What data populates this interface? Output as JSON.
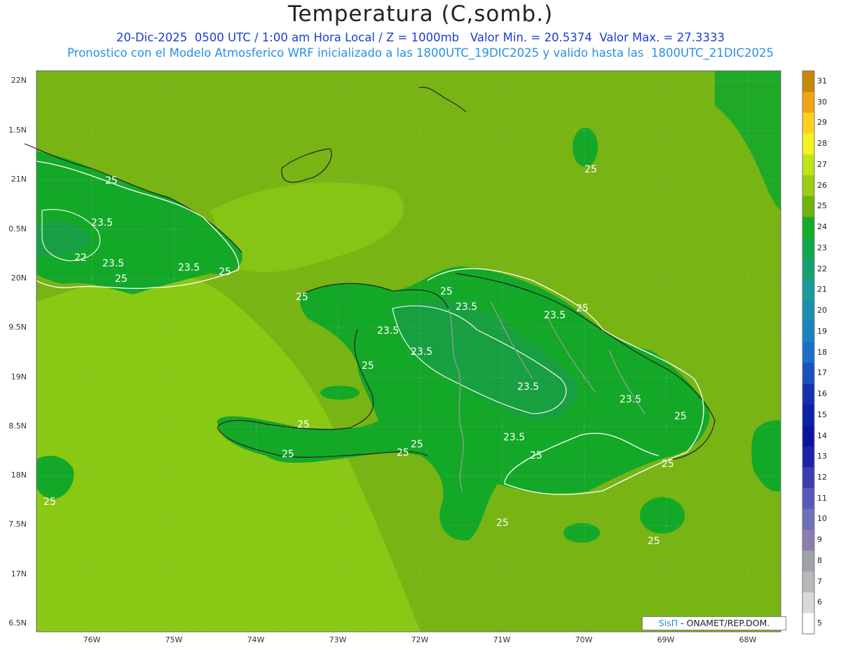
{
  "title": "Temperatura (C,somb.)",
  "subtitle1": "20-Dic-2025  0500 UTC / 1:00 am Hora Local / Z = 1000mb   Valor Min. = 20.5374  Valor Max. = 27.3333",
  "subtitle2": "Pronostico con el Modelo Atmosferico WRF inicializado a las 1800UTC_19DIC2025 y valido hasta las  1800UTC_21DIC2025",
  "lat_labels": [
    "22N",
    "1.5N",
    "21N",
    "0.5N",
    "20N",
    "9.5N",
    "19N",
    "8.5N",
    "18N",
    "7.5N",
    "17N",
    "6.5N"
  ],
  "lon_labels": [
    "76W",
    "75W",
    "74W",
    "73W",
    "72W",
    "71W",
    "70W",
    "69W",
    "68W"
  ],
  "colorbar": {
    "levels": [
      "5",
      "6",
      "7",
      "8",
      "9",
      "10",
      "11",
      "12",
      "13",
      "14",
      "15",
      "16",
      "17",
      "18",
      "19",
      "20",
      "21",
      "22",
      "23",
      "24",
      "25",
      "26",
      "27",
      "28",
      "29",
      "30",
      "31"
    ],
    "colors": [
      "#ffffff",
      "#d9d9d9",
      "#b8b8b8",
      "#a0a0a8",
      "#8c7cb0",
      "#7070b8",
      "#5a58b8",
      "#3a3cb0",
      "#1e22a8",
      "#0a14a0",
      "#0a20a8",
      "#1430b0",
      "#1a50c0",
      "#1a6ec8",
      "#1a82c0",
      "#1a8eb0",
      "#1a9a98",
      "#16a070",
      "#12a84a",
      "#14ac28",
      "#6cb40a",
      "#9ccc14",
      "#bce618",
      "#f4f41c",
      "#ffd21e",
      "#f0a614",
      "#c8880a"
    ]
  },
  "contour_labels": [
    "25",
    "23.5",
    "22",
    "23.5",
    "25",
    "23.5",
    "25",
    "25",
    "23.5",
    "23.5",
    "23.5",
    "25",
    "25",
    "23.5",
    "23.5",
    "25",
    "25",
    "25",
    "25",
    "25",
    "23.5",
    "25",
    "25",
    "23.5",
    "25",
    "25",
    "25",
    "25",
    "25"
  ],
  "credit": {
    "brand": "SisΠ",
    "text": " - ONAMET/REP.DOM."
  },
  "colors": {
    "sea": "#78b414",
    "land": "#14a828",
    "title": "#222222",
    "subtitle1": "#1a3fd6",
    "subtitle2": "#2a8fe8"
  }
}
